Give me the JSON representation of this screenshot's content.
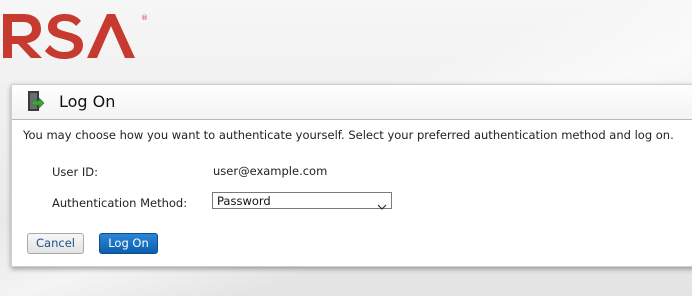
{
  "brand": {
    "logo_text": "RSA",
    "trademark": "®",
    "color": "#c0392b"
  },
  "panel": {
    "title": "Log On",
    "title_icon": "door-arrow-icon",
    "instructions": "You may choose how you want to authenticate yourself. Select your preferred authentication method and log on."
  },
  "form": {
    "userid_label": "User ID:",
    "userid_value": "user@example.com",
    "method_label": "Authentication Method:",
    "method_selected": "Password"
  },
  "buttons": {
    "cancel_label": "Cancel",
    "logon_label": "Log On",
    "primary_color": "#0c5fae"
  }
}
